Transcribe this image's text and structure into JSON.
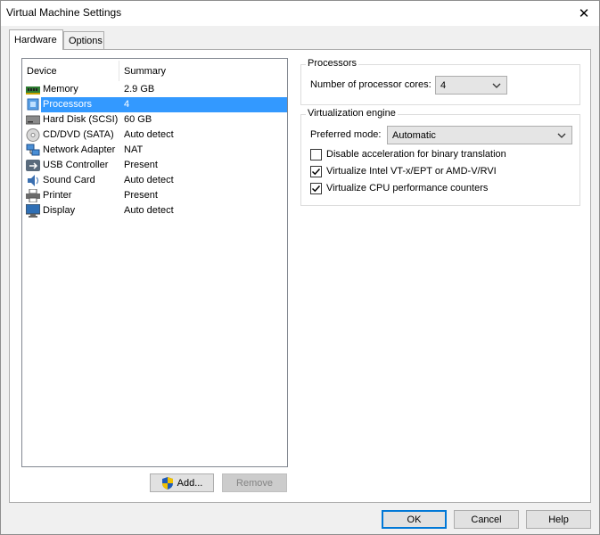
{
  "window": {
    "title": "Virtual Machine Settings"
  },
  "tabs": [
    {
      "label": "Hardware"
    },
    {
      "label": "Options"
    }
  ],
  "device_list": {
    "columns": [
      "Device",
      "Summary"
    ],
    "rows": [
      {
        "name": "Memory",
        "summary": "2.9 GB",
        "icon": "memory-icon"
      },
      {
        "name": "Processors",
        "summary": "4",
        "icon": "processor-icon"
      },
      {
        "name": "Hard Disk (SCSI)",
        "summary": "60 GB",
        "icon": "hard-disk-icon"
      },
      {
        "name": "CD/DVD (SATA)",
        "summary": "Auto detect",
        "icon": "cd-dvd-icon"
      },
      {
        "name": "Network Adapter",
        "summary": "NAT",
        "icon": "network-adapter-icon"
      },
      {
        "name": "USB Controller",
        "summary": "Present",
        "icon": "usb-icon"
      },
      {
        "name": "Sound Card",
        "summary": "Auto detect",
        "icon": "sound-card-icon"
      },
      {
        "name": "Printer",
        "summary": "Present",
        "icon": "printer-icon"
      },
      {
        "name": "Display",
        "summary": "Auto detect",
        "icon": "display-icon"
      }
    ],
    "selected": "Processors"
  },
  "buttons": {
    "add": "Add...",
    "remove": "Remove",
    "ok": "OK",
    "cancel": "Cancel",
    "help": "Help"
  },
  "processors": {
    "group_label": "Processors",
    "cores_label": "Number of processor cores:",
    "cores_value": "4"
  },
  "virtualization": {
    "group_label": "Virtualization engine",
    "mode_label": "Preferred mode:",
    "mode_value": "Automatic",
    "options": [
      {
        "label": "Disable acceleration for binary translation",
        "checked": false
      },
      {
        "label": "Virtualize Intel VT-x/EPT or AMD-V/RVI",
        "checked": true
      },
      {
        "label": "Virtualize CPU performance counters",
        "checked": true
      }
    ]
  },
  "colors": {
    "selection": "#3399ff",
    "default_button_border": "#0078d7"
  }
}
